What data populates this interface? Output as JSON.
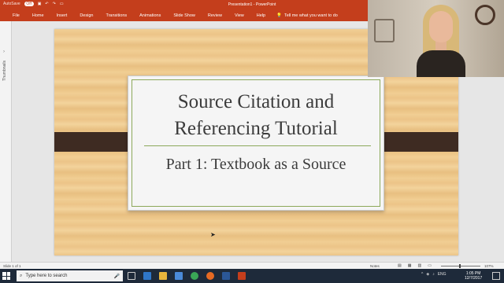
{
  "titlebar": {
    "autosave_label": "AutoSave",
    "autosave_state": "Off",
    "document_title": "Presentation1 - PowerPoint"
  },
  "ribbon": {
    "tabs": [
      "File",
      "Home",
      "Insert",
      "Design",
      "Transitions",
      "Animations",
      "Slide Show",
      "Review",
      "View",
      "Help"
    ],
    "tell_me": "Tell me what you want to do",
    "accent_color": "#c43e1c"
  },
  "thumbnails_panel": {
    "label": "Thumbnails"
  },
  "slide": {
    "title": "Source Citation and Referencing Tutorial",
    "subtitle": "Part 1: Textbook as a Source"
  },
  "statusbar": {
    "slide_indicator": "Slide 1 of 1",
    "notes_label": "Notes",
    "zoom": "107%"
  },
  "taskbar": {
    "search_placeholder": "Type here to search",
    "time": "1:05 PM",
    "date": "12/7/2017",
    "lang": "ENG"
  }
}
